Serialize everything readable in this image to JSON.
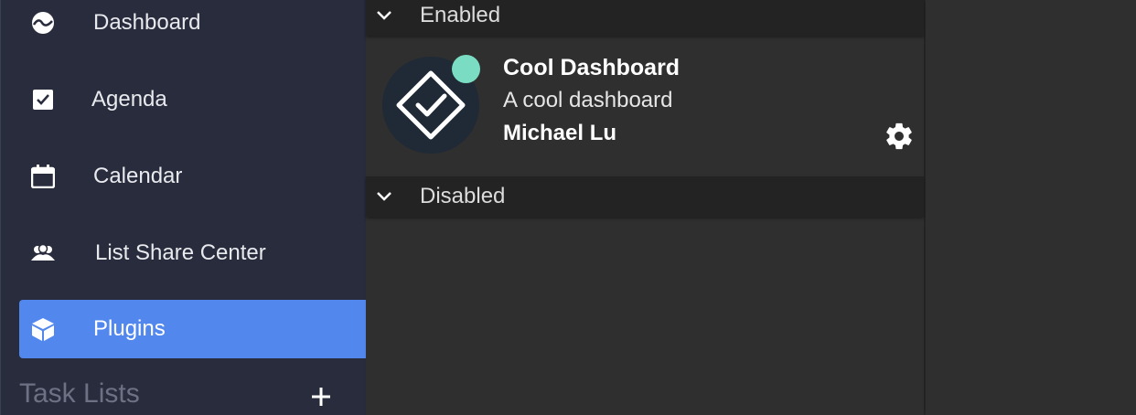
{
  "sidebar": {
    "items": [
      {
        "label": "Dashboard",
        "icon": "dashboard-icon"
      },
      {
        "label": "Agenda",
        "icon": "check-square-icon"
      },
      {
        "label": "Calendar",
        "icon": "calendar-icon"
      },
      {
        "label": "List Share Center",
        "icon": "people-icon"
      },
      {
        "label": "Plugins",
        "icon": "cube-icon",
        "active": true
      }
    ],
    "section_title": "Task Lists",
    "add_icon": "plus-icon"
  },
  "plugins": {
    "enabled_label": "Enabled",
    "disabled_label": "Disabled",
    "enabled": [
      {
        "name": "Cool Dashboard",
        "description": "A cool dashboard",
        "author": "Michael Lu",
        "status_color": "#7adcc2",
        "icon": "checkmark-diamond-icon"
      }
    ]
  },
  "colors": {
    "sidebar_bg": "#282c3d",
    "active_accent": "#5288ee",
    "main_bg": "#2f2f2f",
    "header_bg": "#232323"
  }
}
